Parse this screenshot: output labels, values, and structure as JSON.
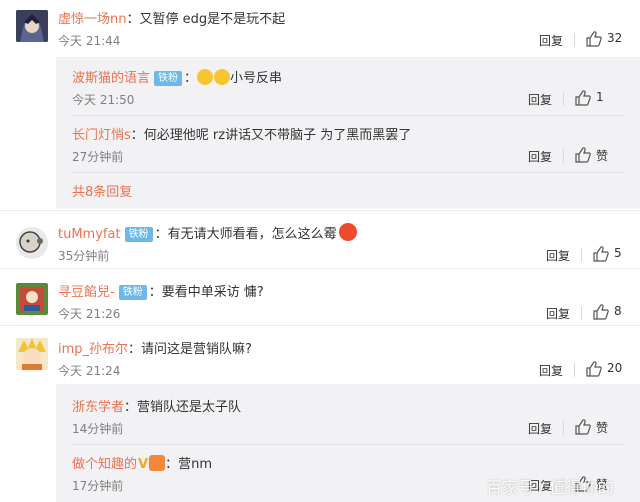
{
  "comments": [
    {
      "user": "虚惊一场nn",
      "text": "又暂停 edg是不是玩不起",
      "time": "今天 21:44",
      "reply_label": "回复",
      "likes": "32"
    },
    {
      "user": "tuMmyfat",
      "badge": "铁粉",
      "text": "有无请大师看看，怎么这么霉",
      "time": "35分钟前",
      "reply_label": "回复",
      "likes": "5"
    },
    {
      "user": "寻豆餡兒-",
      "badge": "铁粉",
      "text": "要看中单采访 慵?",
      "time": "今天 21:26",
      "reply_label": "回复",
      "likes": "8"
    },
    {
      "user": "imp_孙布尔",
      "text": "请问这是营销队嘛?",
      "time": "今天 21:24",
      "reply_label": "回复",
      "likes": "20"
    }
  ],
  "replies_group1": [
    {
      "user": "波斯猫的语言",
      "badge": "铁粉",
      "text": "小号反串",
      "time": "今天 21:50",
      "reply_label": "回复",
      "likes": "1"
    },
    {
      "user": "长门灯悄s",
      "text": "何必理他呢 rz讲话又不带脑子 为了黑而黑罢了",
      "time": "27分钟前",
      "reply_label": "回复",
      "likes": "赞"
    }
  ],
  "more_replies": "共8条回复",
  "replies_group2": [
    {
      "user": "浙东学者",
      "text": "营销队还是太子队",
      "time": "14分钟前",
      "reply_label": "回复",
      "likes": "赞"
    },
    {
      "user": "做个知趣的",
      "text": "营nm",
      "time": "17分钟前",
      "reply_label": "回复",
      "likes": "赞"
    }
  ],
  "watermark": "百家号 / 值得你的"
}
